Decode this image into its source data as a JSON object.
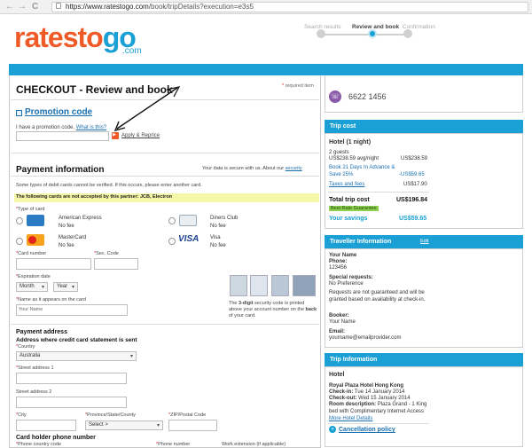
{
  "browser": {
    "back_glyph": "←",
    "forward_glyph": "→",
    "reload_glyph": "C",
    "url_host": "https://www.ratestogo.com",
    "url_path": "/book/tripDetails?execution=e3s5"
  },
  "logo": {
    "rates": "rates",
    "to": "to",
    "go": "go",
    "com": ".com"
  },
  "steps": {
    "s1": "Search results",
    "s2": "Review and book",
    "s3": "Confirmation"
  },
  "checkout": {
    "title": "CHECKOUT - Review and book",
    "required_note": "required item",
    "required_star": "*"
  },
  "promo": {
    "title": "Promotion code",
    "prompt": "I have a promotion code.",
    "what_link": "What is this?",
    "apply_label": "Apply & Reprice"
  },
  "payment": {
    "title": "Payment information",
    "secure_text": "Your data is secure with us. About our",
    "secure_link": "security",
    "debit_note": "Some types of debit cards cannot be verified. If this occurs, please enter another card.",
    "warning": "The following cards are not accepted by this partner: JCB, Electron",
    "type_label": "Type of card",
    "cards": {
      "amex": {
        "name": "American Express",
        "fee": "No fee"
      },
      "diners": {
        "name": "Diners Club",
        "fee": "No fee"
      },
      "mastercard": {
        "name": "MasterCard",
        "fee": "No fee"
      },
      "visa": {
        "name": "Visa",
        "fee": "No fee"
      }
    },
    "card_number_label": "Card number",
    "sec_code_label": "Sec. Code",
    "expiration_label": "Expiration date",
    "month_value": "Month",
    "year_value": "Year",
    "name_label": "Name as it appears on the card",
    "name_placeholder": "Your Name",
    "security_note_pre": "The",
    "security_note_bold": "3-digit",
    "security_note_mid": "security code is printed above your account number on the",
    "security_note_back": "back",
    "security_note_end": "of your card."
  },
  "address": {
    "title": "Payment address",
    "subtitle": "Address where credit card statement is sent",
    "country_label": "Country",
    "country_value": "Australia",
    "street1_label": "Street address 1",
    "street2_label": "Street address 2",
    "city_label": "City",
    "province_label": "Province/State/County",
    "province_value": "Select >",
    "zip_label": "ZIP/Postal Code"
  },
  "phone_section": {
    "title": "Card holder phone number",
    "country_code_label": "Phone country code",
    "phone_label": "Phone number",
    "work_ext_label": "Work extension (if applicable)"
  },
  "sidebar": {
    "phone": "6622 1456",
    "trip_cost": {
      "header": "Trip cost",
      "hotel": "Hotel (1 night)",
      "guests": "2 guests",
      "avg_rate": "US$238.59 avg/night",
      "avg_total": "US$238.59",
      "promo_text": "Book 21 Days In Advance & Save 25%",
      "promo_amount": "-US$59.65",
      "taxes_label": "Taxes and fees",
      "taxes_amount": "US$17.90",
      "total_label": "Total trip cost",
      "total_amount": "US$196.84",
      "best_rate": "Best Rate Guarantee",
      "savings_label": "Your savings",
      "savings_amount": "US$59.65"
    },
    "traveller": {
      "header": "Traveller Information",
      "edit": "Edit",
      "name": "Your Name",
      "phone_label": "Phone:",
      "phone_value": "123456",
      "special_label": "Special requests:",
      "special_value": "No Preference",
      "notice": "Requests are not guaranteed and will be granted based on availability at check-in.",
      "booker_label": "Booker:",
      "booker_value": "Your Name",
      "email_label": "Email:",
      "email_value": "yourname@emailprovider.com"
    },
    "trip_info": {
      "header": "Trip Information",
      "hotel_label": "Hotel",
      "hotel_name": "Royal Plaza Hotel Hong Kong",
      "checkin_label": "Check-in:",
      "checkin_value": "Tue 14 January 2014",
      "checkout_label": "Check-out:",
      "checkout_value": "Wed 15 January 2014",
      "room_label": "Room description:",
      "room_value": "Plaza Grand - 1 King bed with Complimentary Internet Access",
      "more_link": "More Hotel Details",
      "cancel_link": "Cancellation policy"
    }
  },
  "colors": {
    "brand_orange": "#ef5a28",
    "brand_blue": "#1aa0d4",
    "link_blue": "#1a6fae"
  }
}
